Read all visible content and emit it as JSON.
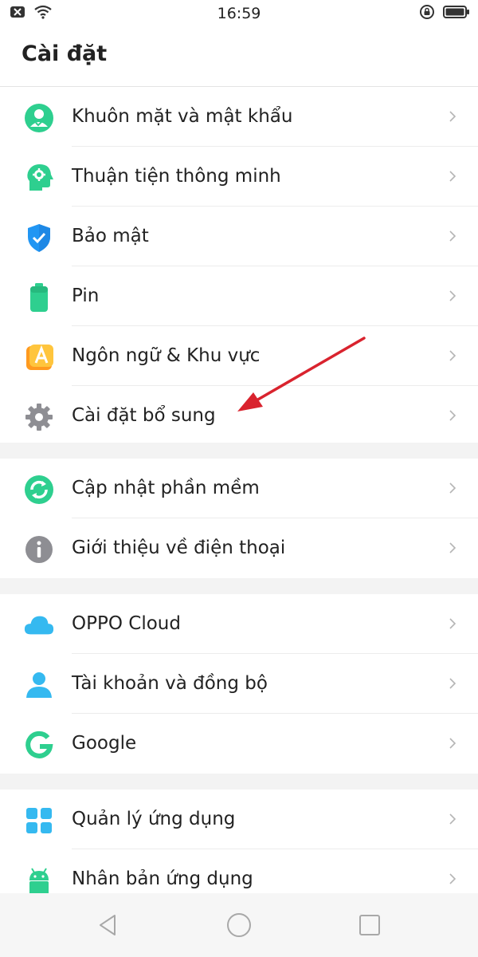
{
  "status": {
    "time": "16:59"
  },
  "page": {
    "title": "Cài đặt"
  },
  "sections": [
    {
      "items": [
        {
          "label": "Khuôn mặt và mật khẩu",
          "icon": "face-password-icon"
        },
        {
          "label": "Thuận tiện thông minh",
          "icon": "smart-assist-icon"
        },
        {
          "label": "Bảo mật",
          "icon": "shield-icon"
        },
        {
          "label": "Pin",
          "icon": "battery-icon"
        },
        {
          "label": "Ngôn ngữ & Khu vực",
          "icon": "language-icon"
        },
        {
          "label": "Cài đặt bổ sung",
          "icon": "gear-icon"
        }
      ]
    },
    {
      "items": [
        {
          "label": "Cập nhật phần mềm",
          "icon": "software-update-icon"
        },
        {
          "label": "Giới thiệu về điện thoại",
          "icon": "info-icon"
        }
      ]
    },
    {
      "items": [
        {
          "label": "OPPO Cloud",
          "icon": "cloud-icon"
        },
        {
          "label": "Tài khoản và đồng bộ",
          "icon": "account-icon"
        },
        {
          "label": "Google",
          "icon": "google-icon"
        }
      ]
    },
    {
      "items": [
        {
          "label": "Quản lý ứng dụng",
          "icon": "app-grid-icon"
        },
        {
          "label": "Nhân bản ứng dụng",
          "icon": "android-icon"
        }
      ]
    }
  ],
  "colors": {
    "accent_green": "#2ecf8f",
    "shield_blue": "#2196f3",
    "cloud_blue": "#35b9f0",
    "gear_gray": "#8e8e93",
    "language_orange": "#ffb22c",
    "annotation_red": "#d9232e"
  }
}
